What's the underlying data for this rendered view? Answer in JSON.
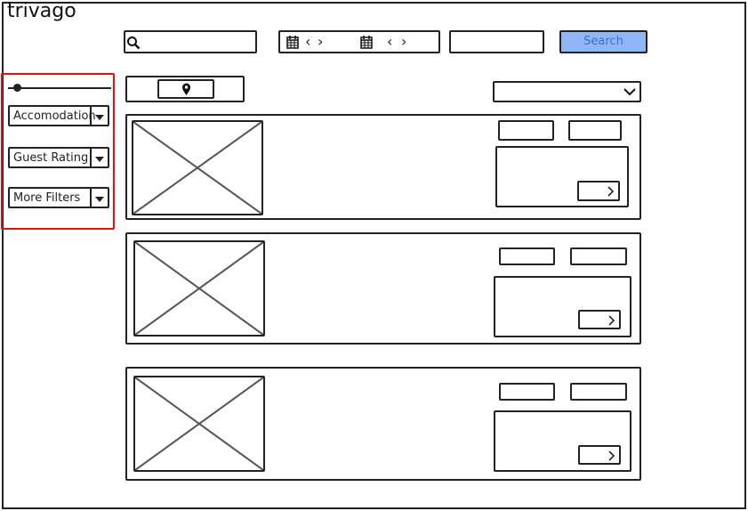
{
  "brand": {
    "logo": "trivago"
  },
  "search": {
    "placeholder": "",
    "button_label": "Search"
  },
  "dates": {
    "checkin_prev": "‹",
    "checkin_next": "›",
    "checkout_prev": "‹",
    "checkout_next": "›"
  },
  "filters": {
    "price_slider_value": 0.1,
    "items": [
      {
        "label": "Accomodation"
      },
      {
        "label": "Guest Rating"
      },
      {
        "label": "More Filters"
      }
    ]
  },
  "results": [
    {
      "image": "image-placeholder"
    },
    {
      "image": "image-placeholder"
    },
    {
      "image": "image-placeholder"
    }
  ],
  "icons": {
    "search": "search-icon",
    "calendar": "calendar-icon",
    "map_pin": "map-pin-icon",
    "chevron_down": "chevron-down-icon",
    "chevron_right": "chevron-right-icon"
  },
  "colors": {
    "search_button": "#8fb7f5",
    "sidebar_border": "#dd1111"
  }
}
